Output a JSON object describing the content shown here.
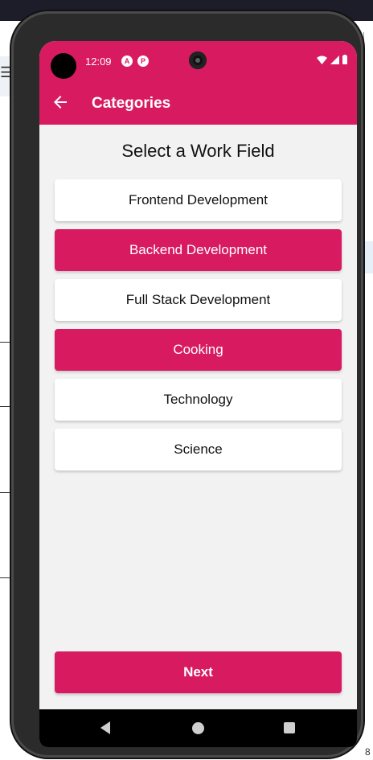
{
  "status_bar": {
    "time": "12:09",
    "icons": [
      "android-studio-icon",
      "app-notification-icon",
      "wifi-icon",
      "cell-signal-icon",
      "battery-icon"
    ]
  },
  "app_bar": {
    "title": "Categories",
    "back_icon": "back-arrow-icon"
  },
  "heading": "Select a Work Field",
  "options": [
    {
      "label": "Frontend Development",
      "selected": false
    },
    {
      "label": "Backend Development",
      "selected": true
    },
    {
      "label": "Full Stack Development",
      "selected": false
    },
    {
      "label": "Cooking",
      "selected": true
    },
    {
      "label": "Technology",
      "selected": false
    },
    {
      "label": "Science",
      "selected": false
    }
  ],
  "next_button": {
    "label": "Next"
  },
  "nav_bar": {
    "icons": [
      "nav-back-icon",
      "nav-home-icon",
      "nav-recents-icon"
    ]
  },
  "colors": {
    "primary": "#d81b60",
    "background": "#f2f2f2",
    "card": "#ffffff"
  }
}
